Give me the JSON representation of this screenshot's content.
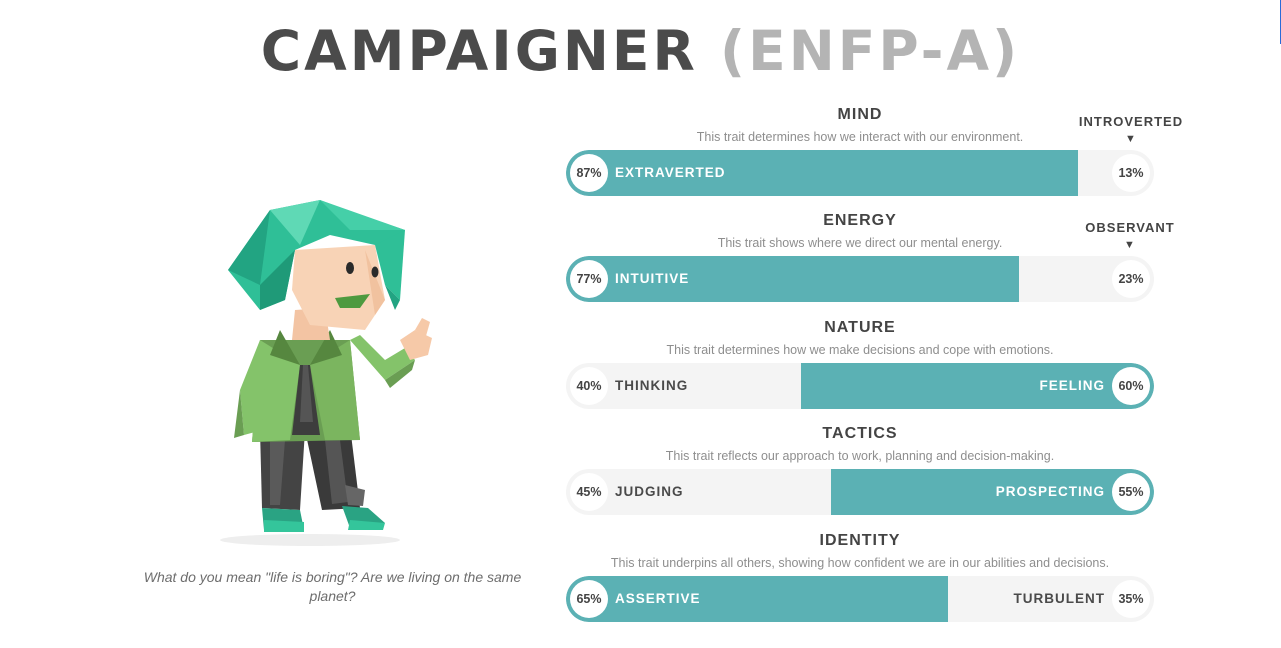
{
  "header": {
    "title_main": "CAMPAIGNER",
    "title_code": "(ENFP-A)"
  },
  "quote": "What do you mean \"life is boring\"? Are we living on the same planet?",
  "colors": {
    "accent": "#5bb1b4",
    "track": "#f4f4f4"
  },
  "traits": [
    {
      "name": "MIND",
      "desc": "This trait determines how we interact with our environment.",
      "opposite": "INTROVERTED",
      "arrow": "▼",
      "left_pct": "87%",
      "left_label": "EXTRAVERTED",
      "right_pct": "13%",
      "right_label": "",
      "dominant": "left",
      "dominant_value": 87
    },
    {
      "name": "ENERGY",
      "desc": "This trait shows where we direct our mental energy.",
      "opposite": "OBSERVANT",
      "arrow": "▼",
      "left_pct": "77%",
      "left_label": "INTUITIVE",
      "right_pct": "23%",
      "right_label": "",
      "dominant": "left",
      "dominant_value": 77
    },
    {
      "name": "NATURE",
      "desc": "This trait determines how we make decisions and cope with emotions.",
      "opposite": "",
      "arrow": "",
      "left_pct": "40%",
      "left_label": "THINKING",
      "right_pct": "60%",
      "right_label": "FEELING",
      "dominant": "right",
      "dominant_value": 60
    },
    {
      "name": "TACTICS",
      "desc": "This trait reflects our approach to work, planning and decision-making.",
      "opposite": "",
      "arrow": "",
      "left_pct": "45%",
      "left_label": "JUDGING",
      "right_pct": "55%",
      "right_label": "PROSPECTING",
      "dominant": "right",
      "dominant_value": 55
    },
    {
      "name": "IDENTITY",
      "desc": "This trait underpins all others, showing how confident we are in our abilities and decisions.",
      "opposite": "",
      "arrow": "",
      "left_pct": "65%",
      "left_label": "ASSERTIVE",
      "right_pct": "35%",
      "right_label": "TURBULENT",
      "dominant": "left",
      "dominant_value": 65
    }
  ]
}
